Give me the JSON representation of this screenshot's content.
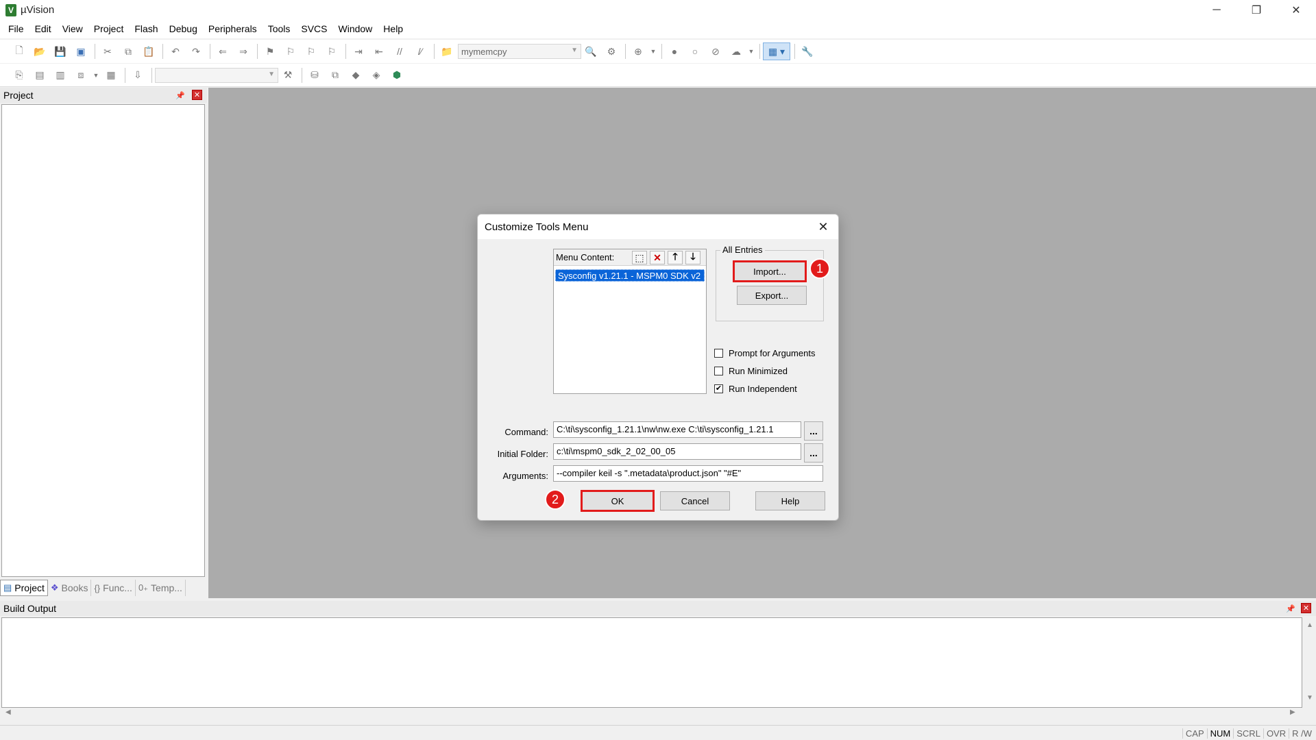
{
  "window": {
    "title": "µVision",
    "icon": "uvision-app-icon",
    "minimize": "─",
    "maximize": "❐",
    "close": "✕"
  },
  "menu": [
    "File",
    "Edit",
    "View",
    "Project",
    "Flash",
    "Debug",
    "Peripherals",
    "Tools",
    "SVCS",
    "Window",
    "Help"
  ],
  "toolbar": {
    "target_combo": "mymemcpy"
  },
  "project_panel": {
    "title": "Project",
    "tabs": [
      "Project",
      "Books",
      "Func...",
      "Temp..."
    ]
  },
  "build_output": {
    "title": "Build Output"
  },
  "statusbar": [
    "CAP",
    "NUM",
    "SCRL",
    "OVR",
    "R /W"
  ],
  "dialog": {
    "title": "Customize Tools Menu",
    "menu_content_label": "Menu Content:",
    "menu_entry": "Sysconfig v1.21.1 - MSPM0 SDK v2",
    "all_entries_label": "All Entries",
    "import_label": "Import...",
    "export_label": "Export...",
    "checkboxes": [
      {
        "label": "Prompt for  Arguments",
        "checked": false
      },
      {
        "label": "Run Minimized",
        "checked": false
      },
      {
        "label": "Run Independent",
        "checked": true
      }
    ],
    "command_label": "Command:",
    "command_value": "C:\\ti\\sysconfig_1.21.1\\nw\\nw.exe C:\\ti\\sysconfig_1.21.1",
    "initial_folder_label": "Initial Folder:",
    "initial_folder_value": "c:\\ti\\mspm0_sdk_2_02_00_05",
    "arguments_label": "Arguments:",
    "arguments_value": "--compiler keil -s \".metadata\\product.json\" \"#E\"",
    "browse_label": "...",
    "ok_label": "OK",
    "cancel_label": "Cancel",
    "help_label": "Help",
    "badge_1": "1",
    "badge_2": "2"
  },
  "colors": {
    "highlight": "#e21b1b",
    "selection": "#0a64d8",
    "workspace": "#ababab"
  }
}
